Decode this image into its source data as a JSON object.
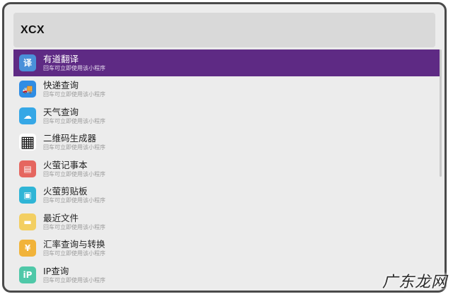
{
  "search": {
    "value": "XCX",
    "placeholder": ""
  },
  "results": [
    {
      "title": "有道翻译",
      "subtitle": "回车可立即使用该小程序",
      "icon": "youdao-translate-icon",
      "color": "#4a90d9",
      "glyph": "译",
      "selected": true
    },
    {
      "title": "快递查询",
      "subtitle": "回车可立即使用该小程序",
      "icon": "delivery-truck-icon",
      "color": "#2f8de4",
      "glyph": "🚚",
      "selected": false
    },
    {
      "title": "天气查询",
      "subtitle": "回车可立即使用该小程序",
      "icon": "weather-cloud-icon",
      "color": "#35a7e6",
      "glyph": "☁",
      "selected": false
    },
    {
      "title": "二维码生成器",
      "subtitle": "回车可立即使用该小程序",
      "icon": "qr-code-icon",
      "color": "#ffffff",
      "glyph": "▦",
      "selected": false
    },
    {
      "title": "火萤记事本",
      "subtitle": "回车可立即使用该小程序",
      "icon": "notebook-icon",
      "color": "#e5665f",
      "glyph": "▤",
      "selected": false
    },
    {
      "title": "火萤剪贴板",
      "subtitle": "回车可立即使用该小程序",
      "icon": "clipboard-icon",
      "color": "#2fb5d6",
      "glyph": "▣",
      "selected": false
    },
    {
      "title": "最近文件",
      "subtitle": "回车可立即使用该小程序",
      "icon": "folder-icon",
      "color": "#f3cf62",
      "glyph": "▬",
      "selected": false
    },
    {
      "title": "汇率查询与转换",
      "subtitle": "回车可立即使用该小程序",
      "icon": "yen-currency-icon",
      "color": "#f1b33a",
      "glyph": "¥",
      "selected": false
    },
    {
      "title": "IP查询",
      "subtitle": "回车可立即使用该小程序",
      "icon": "ip-icon",
      "color": "#4fc8a8",
      "glyph": "iP",
      "selected": false
    }
  ],
  "watermark": "广东龙网"
}
